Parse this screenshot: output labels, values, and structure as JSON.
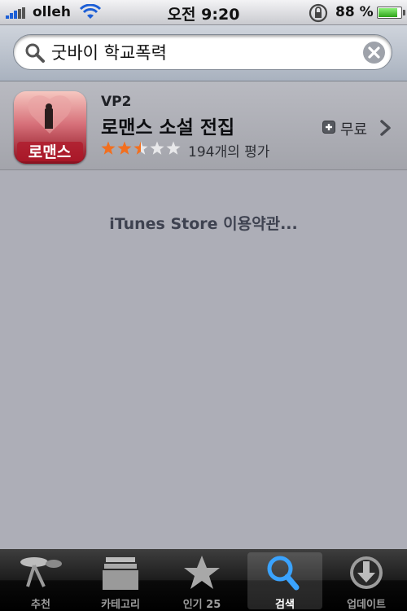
{
  "status_bar": {
    "carrier": "olleh",
    "time": "오전 9:20",
    "battery_percent": "88 %",
    "battery_level": 0.88
  },
  "search": {
    "query": "굿바이 학교폭력"
  },
  "results": [
    {
      "seller": "VP2",
      "title": "로맨스 소설 전집",
      "icon_text": "로맨스",
      "rating": 2.5,
      "rating_max": 5,
      "rating_count": "194개의 평가",
      "price": "무료"
    }
  ],
  "footer_link": "iTunes Store 이용약관...",
  "tabs": [
    {
      "label": "추천",
      "icon": "featured-icon",
      "active": false
    },
    {
      "label": "카테고리",
      "icon": "categories-icon",
      "active": false
    },
    {
      "label": "인기 25",
      "icon": "top25-star-icon",
      "active": false
    },
    {
      "label": "검색",
      "icon": "search-icon",
      "active": true
    },
    {
      "label": "업데이트",
      "icon": "updates-icon",
      "active": false
    }
  ],
  "colors": {
    "accent_blue": "#1d5fd6",
    "star_orange": "#f26f1f",
    "battery_green": "#2ea41a"
  }
}
